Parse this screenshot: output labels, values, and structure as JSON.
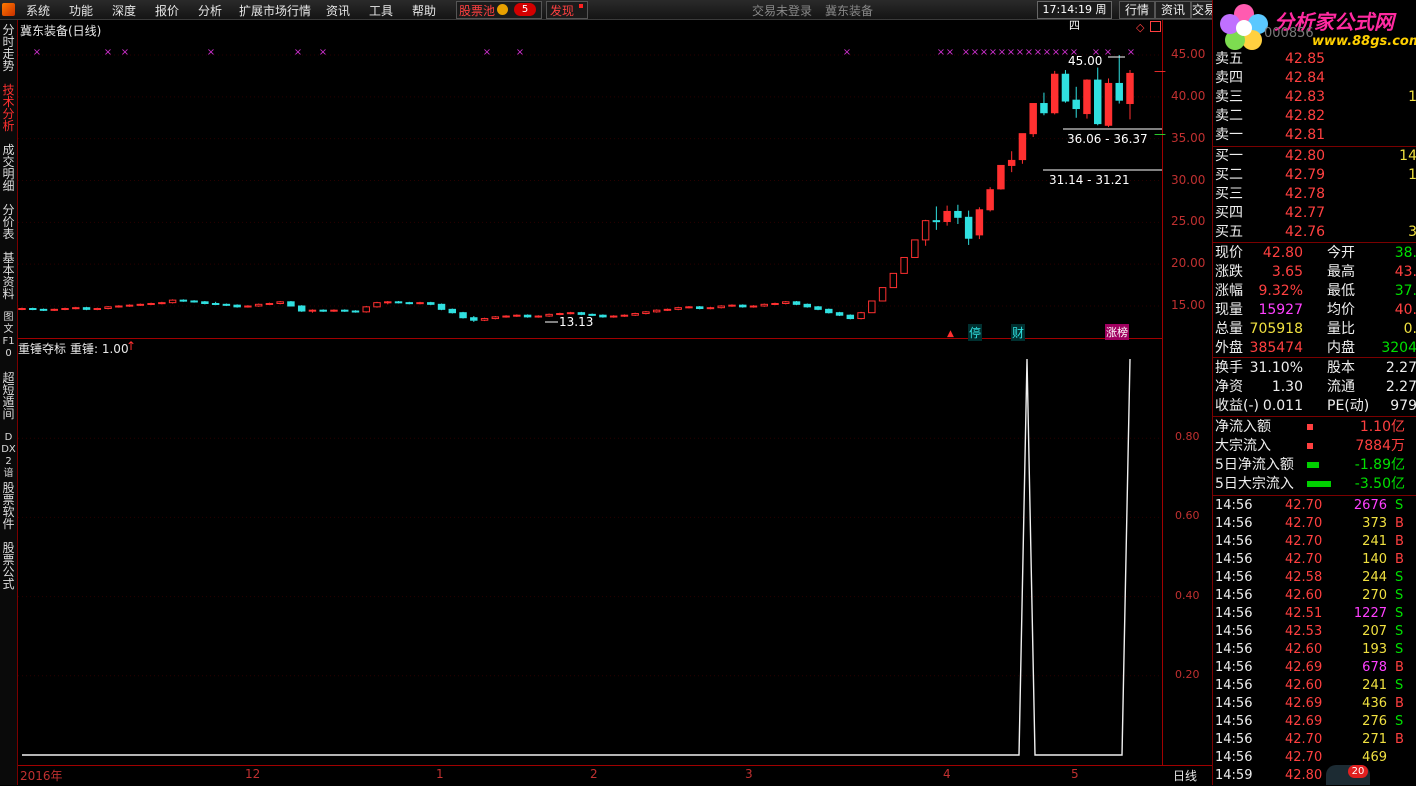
{
  "menu": [
    "系统",
    "功能",
    "深度",
    "报价",
    "分析",
    "扩展市场行情",
    "资讯",
    "工具",
    "帮助"
  ],
  "stock_pool": {
    "label": "股票池",
    "count": "5"
  },
  "discover": "发现",
  "login_status": "交易未登录",
  "center_name": "冀东装备",
  "clock": "17:14:19 周四",
  "right_buttons": [
    "行情",
    "资讯",
    "交易"
  ],
  "brand": {
    "title": "分析家公式网",
    "url": "www.88gs.com",
    "code": "000856"
  },
  "left_tabs": [
    {
      "label": "分时走势",
      "active": false
    },
    {
      "label": "技术分析",
      "active": true
    },
    {
      "label": "成交明细",
      "active": false
    },
    {
      "label": "分价表",
      "active": false
    },
    {
      "label": "基本资料",
      "active": false
    },
    {
      "label": "图文F10",
      "active": false
    },
    {
      "label": "超短遁间",
      "active": false
    },
    {
      "label": "DDX2谙",
      "active": false
    },
    {
      "label": "股票软件",
      "active": false
    },
    {
      "label": "股票公式",
      "active": false
    }
  ],
  "main_chart": {
    "title": "冀东装备(日线)",
    "price_ticks": [
      "45.00",
      "40.00",
      "35.00",
      "30.00",
      "25.00",
      "20.00",
      "15.00"
    ],
    "annotations": {
      "high": "45.00",
      "low": "13.13",
      "range1": "36.06 - 36.37",
      "range2": "31.14 - 31.21"
    },
    "event_tags": [
      "停",
      "财",
      "涨榜"
    ],
    "colors": {
      "up": "#ff3030",
      "down": "#30e0e0",
      "marker": "#d030d0"
    }
  },
  "indicator": {
    "title": "重锤夺标",
    "param": "重锤: 1.00",
    "ticks": [
      "0.80",
      "0.60",
      "0.40",
      "0.20"
    ]
  },
  "date_axis": {
    "labels": [
      "2016年",
      "12",
      "1",
      "2",
      "3",
      "4",
      "5"
    ],
    "period": "日线"
  },
  "order_book": {
    "sells": [
      {
        "label": "卖五",
        "price": "42.85",
        "vol": ""
      },
      {
        "label": "卖四",
        "price": "42.84",
        "vol": ""
      },
      {
        "label": "卖三",
        "price": "42.83",
        "vol": "1"
      },
      {
        "label": "卖二",
        "price": "42.82",
        "vol": ""
      },
      {
        "label": "卖一",
        "price": "42.81",
        "vol": ""
      }
    ],
    "buys": [
      {
        "label": "买一",
        "price": "42.80",
        "vol": "14"
      },
      {
        "label": "买二",
        "price": "42.79",
        "vol": "1"
      },
      {
        "label": "买三",
        "price": "42.78",
        "vol": ""
      },
      {
        "label": "买四",
        "price": "42.77",
        "vol": ""
      },
      {
        "label": "买五",
        "price": "42.76",
        "vol": "3"
      }
    ]
  },
  "stats": [
    {
      "l1": "现价",
      "v1": "42.80",
      "c1": "red",
      "l2": "今开",
      "v2": "38.",
      "c2": "green"
    },
    {
      "l1": "涨跌",
      "v1": "3.65",
      "c1": "red",
      "l2": "最高",
      "v2": "43.",
      "c2": "red"
    },
    {
      "l1": "涨幅",
      "v1": "9.32%",
      "c1": "red",
      "l2": "最低",
      "v2": "37.",
      "c2": "green"
    },
    {
      "l1": "现量",
      "v1": "15927",
      "c1": "mag",
      "l2": "均价",
      "v2": "40.",
      "c2": "red"
    },
    {
      "l1": "总量",
      "v1": "705918",
      "c1": "yel",
      "l2": "量比",
      "v2": "0.",
      "c2": "yel"
    },
    {
      "l1": "外盘",
      "v1": "385474",
      "c1": "red",
      "l2": "内盘",
      "v2": "3204",
      "c2": "green"
    },
    {
      "l1": "换手",
      "v1": "31.10%",
      "c1": "wht",
      "l2": "股本",
      "v2": "2.27",
      "c2": "wht"
    },
    {
      "l1": "净资",
      "v1": "1.30",
      "c1": "wht",
      "l2": "流通",
      "v2": "2.27",
      "c2": "wht"
    },
    {
      "l1": "收益(-)",
      "v1": "0.011",
      "c1": "wht",
      "l2": "PE(动)",
      "v2": "979",
      "c2": "wht"
    }
  ],
  "flows": [
    {
      "label": "净流入额",
      "value": "1.10亿",
      "color": "red",
      "bar": "small-red"
    },
    {
      "label": "大宗流入",
      "value": "7884万",
      "color": "red",
      "bar": "small-red"
    },
    {
      "label": "5日净流入额",
      "value": "-1.89亿",
      "color": "green",
      "bar": "mid-green"
    },
    {
      "label": "5日大宗流入",
      "value": "-3.50亿",
      "color": "green",
      "bar": "long-green"
    }
  ],
  "ticks": [
    {
      "t": "14:56",
      "p": "42.70",
      "v": "2676",
      "vc": "mag",
      "d": "S"
    },
    {
      "t": "14:56",
      "p": "42.70",
      "v": "373",
      "vc": "yel",
      "d": "B"
    },
    {
      "t": "14:56",
      "p": "42.70",
      "v": "241",
      "vc": "yel",
      "d": "B"
    },
    {
      "t": "14:56",
      "p": "42.70",
      "v": "140",
      "vc": "yel",
      "d": "B"
    },
    {
      "t": "14:56",
      "p": "42.58",
      "v": "244",
      "vc": "yel",
      "d": "S"
    },
    {
      "t": "14:56",
      "p": "42.60",
      "v": "270",
      "vc": "yel",
      "d": "S"
    },
    {
      "t": "14:56",
      "p": "42.51",
      "v": "1227",
      "vc": "mag",
      "d": "S"
    },
    {
      "t": "14:56",
      "p": "42.53",
      "v": "207",
      "vc": "yel",
      "d": "S"
    },
    {
      "t": "14:56",
      "p": "42.60",
      "v": "193",
      "vc": "yel",
      "d": "S"
    },
    {
      "t": "14:56",
      "p": "42.69",
      "v": "678",
      "vc": "mag",
      "d": "B"
    },
    {
      "t": "14:56",
      "p": "42.60",
      "v": "241",
      "vc": "yel",
      "d": "S"
    },
    {
      "t": "14:56",
      "p": "42.69",
      "v": "436",
      "vc": "yel",
      "d": "B"
    },
    {
      "t": "14:56",
      "p": "42.69",
      "v": "276",
      "vc": "yel",
      "d": "S"
    },
    {
      "t": "14:56",
      "p": "42.70",
      "v": "271",
      "vc": "yel",
      "d": "B"
    },
    {
      "t": "14:56",
      "p": "42.70",
      "v": "469",
      "vc": "yel",
      "d": ""
    },
    {
      "t": "14:59",
      "p": "42.80",
      "v": "",
      "vc": "yel",
      "d": ""
    }
  ],
  "notif_count": "20",
  "candles": [
    [
      14.6,
      14.8,
      14.5,
      14.7
    ],
    [
      14.7,
      14.8,
      14.5,
      14.6
    ],
    [
      14.6,
      14.7,
      14.4,
      14.5
    ],
    [
      14.5,
      14.7,
      14.4,
      14.6
    ],
    [
      14.6,
      14.8,
      14.5,
      14.7
    ],
    [
      14.7,
      14.9,
      14.6,
      14.8
    ],
    [
      14.8,
      14.9,
      14.5,
      14.6
    ],
    [
      14.6,
      14.8,
      14.5,
      14.7
    ],
    [
      14.7,
      15.0,
      14.6,
      14.9
    ],
    [
      14.9,
      15.1,
      14.8,
      15.0
    ],
    [
      15.0,
      15.2,
      14.9,
      15.1
    ],
    [
      15.1,
      15.3,
      15.0,
      15.2
    ],
    [
      15.2,
      15.4,
      15.1,
      15.3
    ],
    [
      15.3,
      15.5,
      15.2,
      15.4
    ],
    [
      15.4,
      15.8,
      15.3,
      15.7
    ],
    [
      15.7,
      15.8,
      15.5,
      15.6
    ],
    [
      15.6,
      15.7,
      15.4,
      15.5
    ],
    [
      15.5,
      15.6,
      15.2,
      15.3
    ],
    [
      15.3,
      15.5,
      15.1,
      15.2
    ],
    [
      15.2,
      15.3,
      15.0,
      15.1
    ],
    [
      15.1,
      15.2,
      14.8,
      14.9
    ],
    [
      14.9,
      15.1,
      14.8,
      15.0
    ],
    [
      15.0,
      15.3,
      14.9,
      15.2
    ],
    [
      15.2,
      15.4,
      15.1,
      15.3
    ],
    [
      15.3,
      15.6,
      15.2,
      15.5
    ],
    [
      15.5,
      15.6,
      15.0,
      15.0
    ],
    [
      15.0,
      15.1,
      14.3,
      14.4
    ],
    [
      14.4,
      14.6,
      14.2,
      14.5
    ],
    [
      14.5,
      14.6,
      14.3,
      14.4
    ],
    [
      14.4,
      14.6,
      14.3,
      14.5
    ],
    [
      14.5,
      14.6,
      14.3,
      14.4
    ],
    [
      14.4,
      14.5,
      14.2,
      14.3
    ],
    [
      14.3,
      15.0,
      14.2,
      14.9
    ],
    [
      14.9,
      15.5,
      14.8,
      15.4
    ],
    [
      15.4,
      15.6,
      15.2,
      15.5
    ],
    [
      15.5,
      15.6,
      15.3,
      15.4
    ],
    [
      15.4,
      15.5,
      15.2,
      15.3
    ],
    [
      15.3,
      15.5,
      15.2,
      15.4
    ],
    [
      15.4,
      15.5,
      15.1,
      15.2
    ],
    [
      15.2,
      15.3,
      14.5,
      14.6
    ],
    [
      14.6,
      14.7,
      14.1,
      14.2
    ],
    [
      14.2,
      14.3,
      13.5,
      13.6
    ],
    [
      13.6,
      13.8,
      13.1,
      13.3
    ],
    [
      13.3,
      13.6,
      13.2,
      13.5
    ],
    [
      13.5,
      13.8,
      13.4,
      13.7
    ],
    [
      13.7,
      13.9,
      13.6,
      13.8
    ],
    [
      13.8,
      14.0,
      13.7,
      13.9
    ],
    [
      13.9,
      14.0,
      13.6,
      13.7
    ],
    [
      13.7,
      13.9,
      13.6,
      13.8
    ],
    [
      13.8,
      14.1,
      13.7,
      14.0
    ],
    [
      14.0,
      14.2,
      13.9,
      14.1
    ],
    [
      14.1,
      14.3,
      14.0,
      14.2
    ],
    [
      14.2,
      14.3,
      13.9,
      14.0
    ],
    [
      14.0,
      14.1,
      13.8,
      13.9
    ],
    [
      13.9,
      14.0,
      13.6,
      13.7
    ],
    [
      13.7,
      13.9,
      13.6,
      13.8
    ],
    [
      13.8,
      14.0,
      13.7,
      13.9
    ],
    [
      13.9,
      14.2,
      13.8,
      14.1
    ],
    [
      14.1,
      14.4,
      14.0,
      14.3
    ],
    [
      14.3,
      14.6,
      14.2,
      14.5
    ],
    [
      14.5,
      14.7,
      14.4,
      14.6
    ],
    [
      14.6,
      14.9,
      14.5,
      14.8
    ],
    [
      14.8,
      15.0,
      14.7,
      14.9
    ],
    [
      14.9,
      15.0,
      14.6,
      14.7
    ],
    [
      14.7,
      14.9,
      14.6,
      14.8
    ],
    [
      14.8,
      15.1,
      14.7,
      15.0
    ],
    [
      15.0,
      15.2,
      14.9,
      15.1
    ],
    [
      15.1,
      15.2,
      14.8,
      14.9
    ],
    [
      14.9,
      15.1,
      14.8,
      15.0
    ],
    [
      15.0,
      15.3,
      14.9,
      15.2
    ],
    [
      15.2,
      15.4,
      15.1,
      15.3
    ],
    [
      15.3,
      15.6,
      15.2,
      15.5
    ],
    [
      15.5,
      15.6,
      15.1,
      15.2
    ],
    [
      15.2,
      15.3,
      14.8,
      14.9
    ],
    [
      14.9,
      15.0,
      14.5,
      14.6
    ],
    [
      14.6,
      14.7,
      14.1,
      14.2
    ],
    [
      14.2,
      14.3,
      13.8,
      13.9
    ],
    [
      13.9,
      14.0,
      13.4,
      13.5
    ],
    [
      13.5,
      14.3,
      13.4,
      14.2
    ],
    [
      14.2,
      15.6,
      14.2,
      15.6
    ],
    [
      15.6,
      17.2,
      15.6,
      17.2
    ],
    [
      17.2,
      18.9,
      17.2,
      18.9
    ],
    [
      18.9,
      20.8,
      18.9,
      20.8
    ],
    [
      20.8,
      22.9,
      20.8,
      22.9
    ],
    [
      22.9,
      25.3,
      22.2,
      25.2
    ],
    [
      25.2,
      26.9,
      24.1,
      25.1
    ],
    [
      25.1,
      27.0,
      24.6,
      26.3
    ],
    [
      26.3,
      27.1,
      24.8,
      25.6
    ],
    [
      25.6,
      26.4,
      22.3,
      23.1
    ],
    [
      23.5,
      26.8,
      23.0,
      26.5
    ],
    [
      26.5,
      29.2,
      26.3,
      28.9
    ],
    [
      29.0,
      31.8,
      28.9,
      31.8
    ],
    [
      31.8,
      33.5,
      31.0,
      32.4
    ],
    [
      32.5,
      35.6,
      32.0,
      35.6
    ],
    [
      35.6,
      39.2,
      35.2,
      39.2
    ],
    [
      39.2,
      40.5,
      37.8,
      38.1
    ],
    [
      38.1,
      43.1,
      37.9,
      42.7
    ],
    [
      42.7,
      43.2,
      39.3,
      39.5
    ],
    [
      39.6,
      41.2,
      37.5,
      38.6
    ],
    [
      38.0,
      42.1,
      37.4,
      42.0
    ],
    [
      42.0,
      43.5,
      36.6,
      36.8
    ],
    [
      36.6,
      42.2,
      36.4,
      41.6
    ],
    [
      41.6,
      45.0,
      39.2,
      39.6
    ],
    [
      39.2,
      43.2,
      37.3,
      42.8
    ]
  ]
}
